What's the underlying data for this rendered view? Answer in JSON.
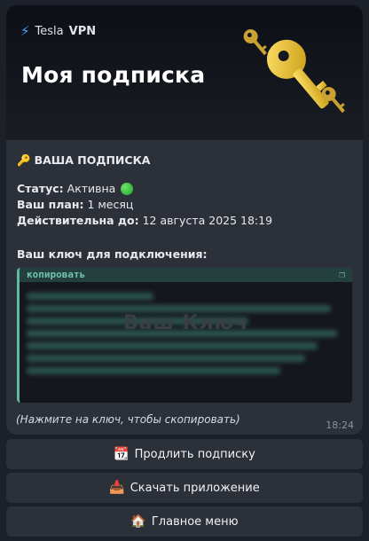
{
  "banner": {
    "brand_prefix": "Tesla",
    "brand_name": "VPN",
    "title": "Моя подписка"
  },
  "subscription": {
    "heading": "ВАША ПОДПИСКА",
    "status_label": "Статус:",
    "status_value": "Активна",
    "plan_label": "Ваш план:",
    "plan_value": "1 месяц",
    "valid_label": "Действительна до:",
    "valid_value": "12 августа 2025 18:19",
    "key_label": "Ваш ключ для подключения:",
    "copy_label": "копировать",
    "key_watermark": "Ваш Ключ",
    "hint": "(Нажмите на ключ, чтобы скопировать)",
    "time": "18:24"
  },
  "buttons": [
    {
      "label": "Продлить подписку",
      "icon": "calendar-icon"
    },
    {
      "label": "Скачать приложение",
      "icon": "inbox-tray-icon"
    },
    {
      "label": "Главное меню",
      "icon": "house-icon"
    }
  ],
  "colors": {
    "accent": "#3ea6ff",
    "code_border": "#5fb8a3",
    "status_dot": "#1ea52a"
  }
}
